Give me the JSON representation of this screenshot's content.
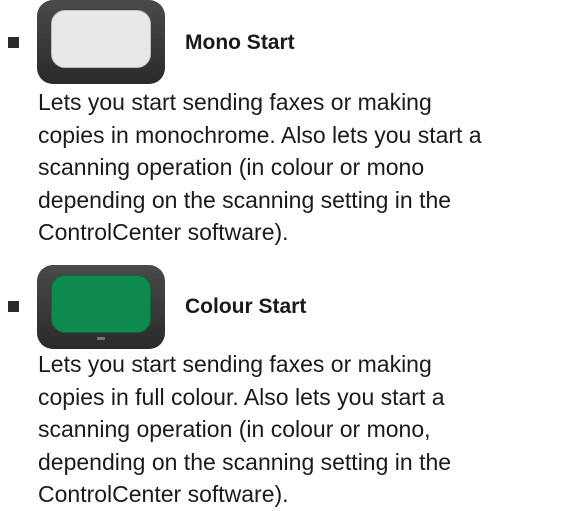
{
  "items": [
    {
      "heading": "Mono Start",
      "button_icon": "mono-start-key-icon",
      "button_color": "#e7e8e8",
      "description_lines": [
        "Lets you start sending faxes or making",
        "copies in monochrome. Also lets you start a",
        "scanning operation (in colour or mono",
        "depending on the scanning setting in the",
        "ControlCenter software)."
      ]
    },
    {
      "heading": "Colour Start",
      "button_icon": "colour-start-key-icon",
      "button_color": "#0e8a4f",
      "description_lines": [
        "Lets you start sending faxes or making",
        "copies in full colour. Also lets you start a",
        "scanning operation (in colour or mono,",
        "depending on the scanning setting in the",
        "ControlCenter software)."
      ]
    }
  ]
}
